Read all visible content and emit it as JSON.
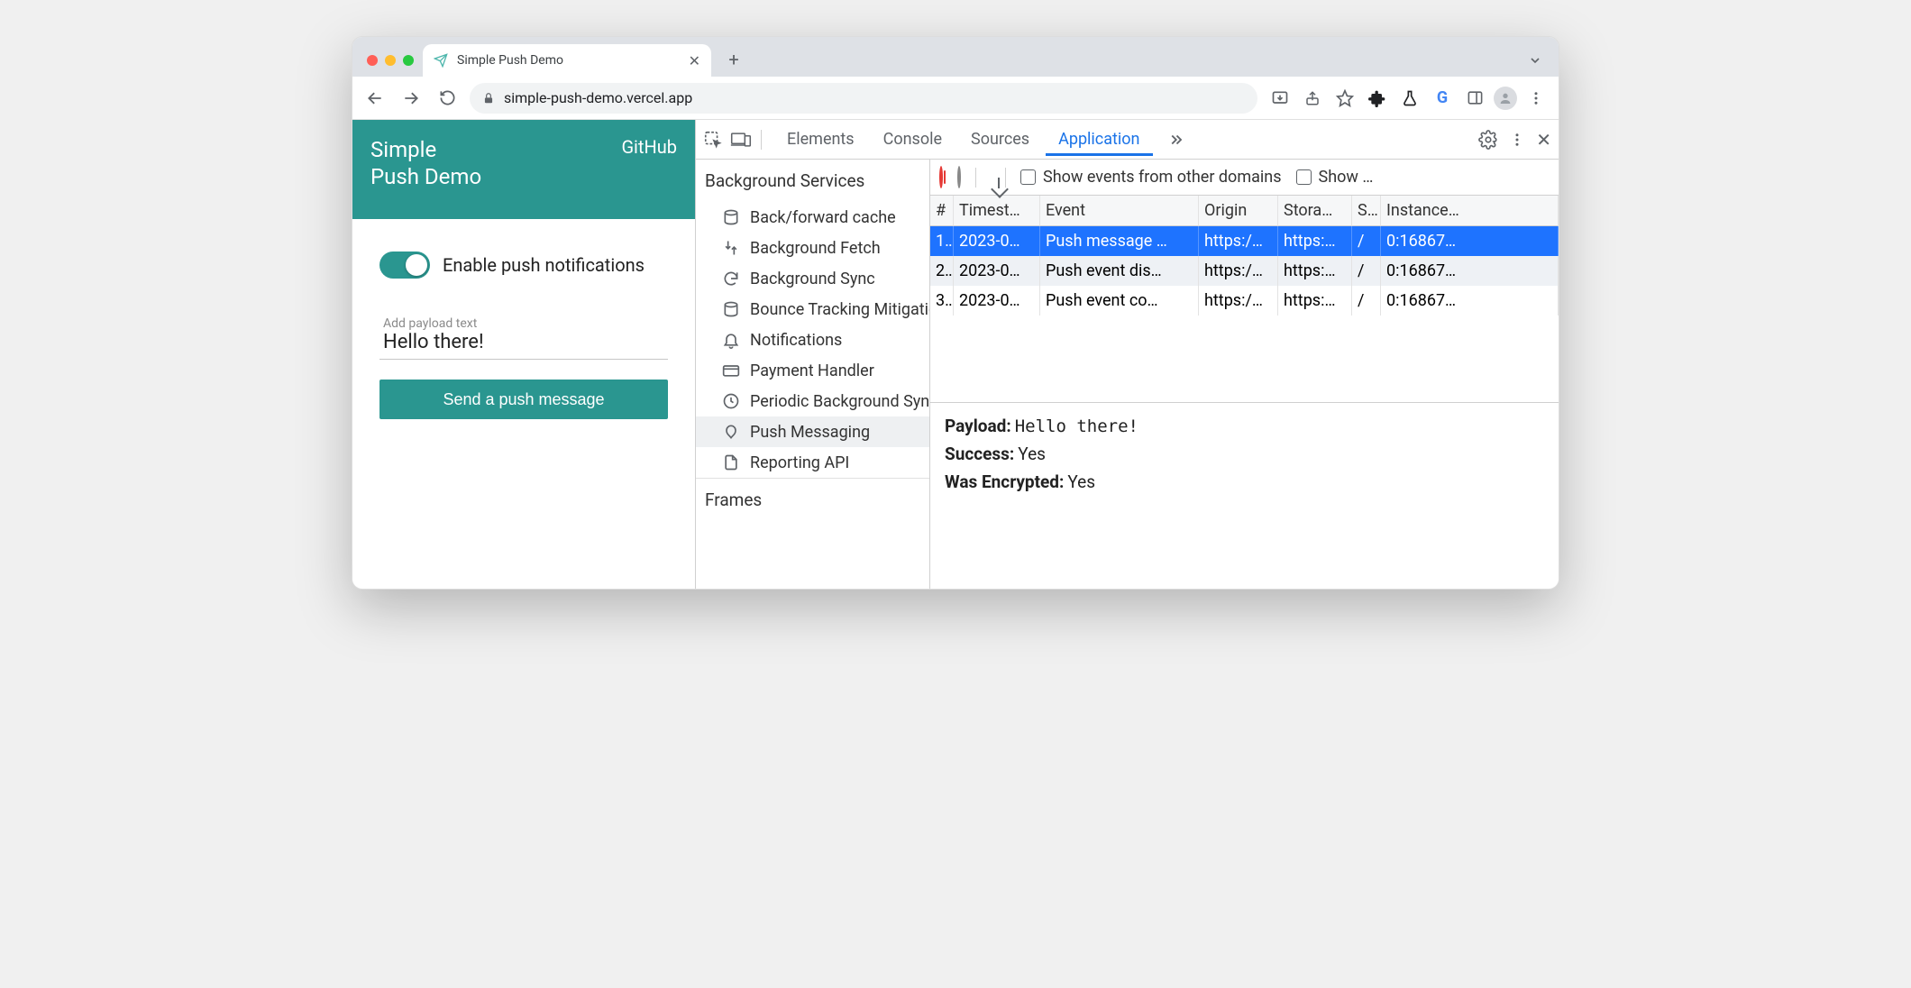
{
  "browser": {
    "tab_title": "Simple Push Demo",
    "url_display": "simple-push-demo.vercel.app"
  },
  "page": {
    "title_line1": "Simple",
    "title_line2": "Push Demo",
    "github_label": "GitHub",
    "toggle_label": "Enable push notifications",
    "toggle_on": true,
    "payload_label": "Add payload text",
    "payload_value": "Hello there!",
    "send_button": "Send a push message"
  },
  "devtools": {
    "tabs": [
      "Elements",
      "Console",
      "Sources",
      "Application"
    ],
    "active_tab": "Application",
    "sidebar_section": "Background Services",
    "sidebar_items": [
      "Back/forward cache",
      "Background Fetch",
      "Background Sync",
      "Bounce Tracking Mitigations",
      "Notifications",
      "Payment Handler",
      "Periodic Background Sync",
      "Push Messaging",
      "Reporting API"
    ],
    "sidebar_selected": "Push Messaging",
    "sidebar_section2": "Frames",
    "toolbar": {
      "show_other_label": "Show events from other domains",
      "show_trunc": "Show …"
    },
    "table": {
      "columns": [
        "#",
        "Timest…",
        "Event",
        "Origin",
        "Stora…",
        "S..",
        "Instance…"
      ],
      "rows": [
        {
          "n": "1.",
          "ts": "2023-0…",
          "event": "Push message …",
          "origin": "https:/…",
          "storage": "https:…",
          "sw": "/",
          "instance": "0:16867…",
          "selected": true
        },
        {
          "n": "2.",
          "ts": "2023-0…",
          "event": "Push event dis…",
          "origin": "https:/…",
          "storage": "https:…",
          "sw": "/",
          "instance": "0:16867…",
          "selected": false
        },
        {
          "n": "3.",
          "ts": "2023-0…",
          "event": "Push event co…",
          "origin": "https:/…",
          "storage": "https:…",
          "sw": "/",
          "instance": "0:16867…",
          "selected": false
        }
      ]
    },
    "details": {
      "payload_k": "Payload:",
      "payload_v": "Hello there!",
      "success_k": "Success:",
      "success_v": "Yes",
      "enc_k": "Was Encrypted:",
      "enc_v": "Yes"
    }
  }
}
